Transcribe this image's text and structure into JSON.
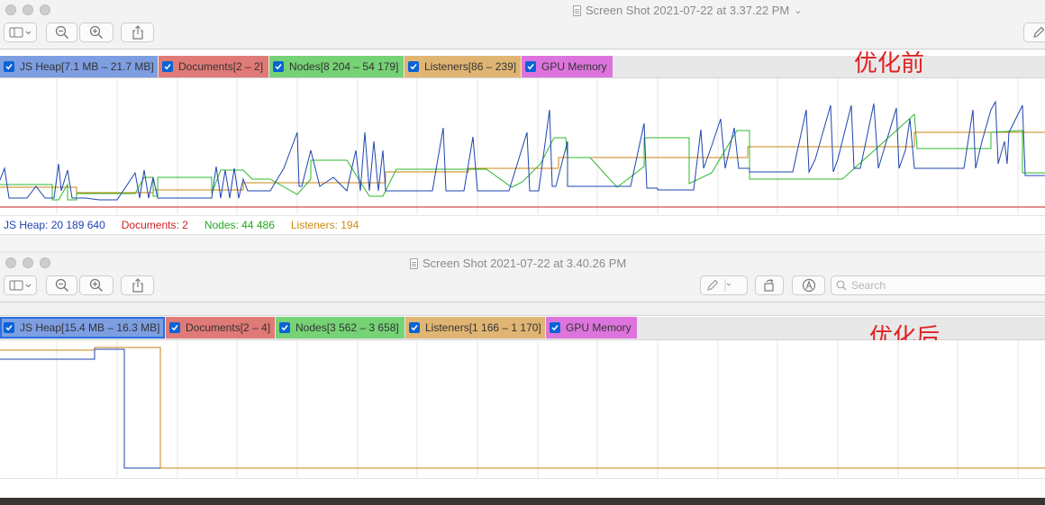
{
  "windows": [
    {
      "title": "Screen Shot 2021-07-22 at 3.37.22 PM",
      "title_chevron": "⌄",
      "annotation": "优化前",
      "legend": [
        {
          "label": "JS Heap[7.1 MB – 21.7 MB]",
          "color": "#7e9ee2"
        },
        {
          "label": "Documents[2 – 2]",
          "color": "#e07a76"
        },
        {
          "label": "Nodes[8 204 – 54 179]",
          "color": "#75d275"
        },
        {
          "label": "Listeners[86 – 239]",
          "color": "#e0b573"
        },
        {
          "label": "GPU Memory",
          "color": "#dd74dd"
        }
      ],
      "stats": [
        {
          "label": "JS Heap: 20 189 640",
          "color": "#1d45b0"
        },
        {
          "label": "Documents: 2",
          "color": "#d02020"
        },
        {
          "label": "Nodes: 44 486",
          "color": "#22aa22"
        },
        {
          "label": "Listeners: 194",
          "color": "#d08a10"
        }
      ]
    },
    {
      "title": "Screen Shot 2021-07-22 at 3.40.26 PM",
      "annotation": "优化后",
      "search_placeholder": "Search",
      "legend": [
        {
          "label": "JS Heap[15.4 MB – 16.3 MB]",
          "color": "#7e9ee2"
        },
        {
          "label": "Documents[2 – 4]",
          "color": "#e07a76"
        },
        {
          "label": "Nodes[3 562 – 3 658]",
          "color": "#75d275"
        },
        {
          "label": "Listeners[1 166 – 1 170]",
          "color": "#e0b573"
        },
        {
          "label": "GPU Memory",
          "color": "#dd74dd"
        }
      ]
    }
  ],
  "series_colors": {
    "js_heap": "#1d45b0",
    "documents": "#c8201c",
    "nodes": "#2cb82c",
    "listeners": "#c98515"
  },
  "icons": [
    "sidebar-icon",
    "zoom-out-icon",
    "zoom-in-icon",
    "share-icon",
    "markup-pen-icon",
    "rotate-icon",
    "annotate-icon",
    "search-icon"
  ]
}
